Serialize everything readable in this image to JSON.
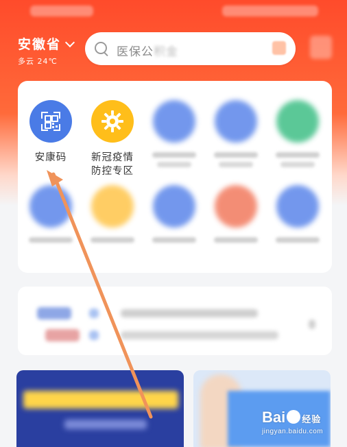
{
  "header": {
    "region_name": "安徽省",
    "weather": "多云 24℃",
    "search_placeholder_visible": "医保公",
    "search_placeholder_blurred": "积金"
  },
  "apps": [
    {
      "label_line1": "安康码",
      "label_line2": "",
      "color": "#4a7be6",
      "icon": "qr-code-icon"
    },
    {
      "label_line1": "新冠疫情",
      "label_line2": "防控专区",
      "color": "#ffbe1a",
      "icon": "gear-icon"
    }
  ],
  "watermark": {
    "brand": "Bai",
    "brand2": "经验",
    "url": "jingyan.baidu.com"
  },
  "colors": {
    "header_red": "#ff4b2b",
    "annotation_arrow": "#f0935a",
    "app_blue": "#4a7be6",
    "app_yellow": "#ffbe1a"
  }
}
